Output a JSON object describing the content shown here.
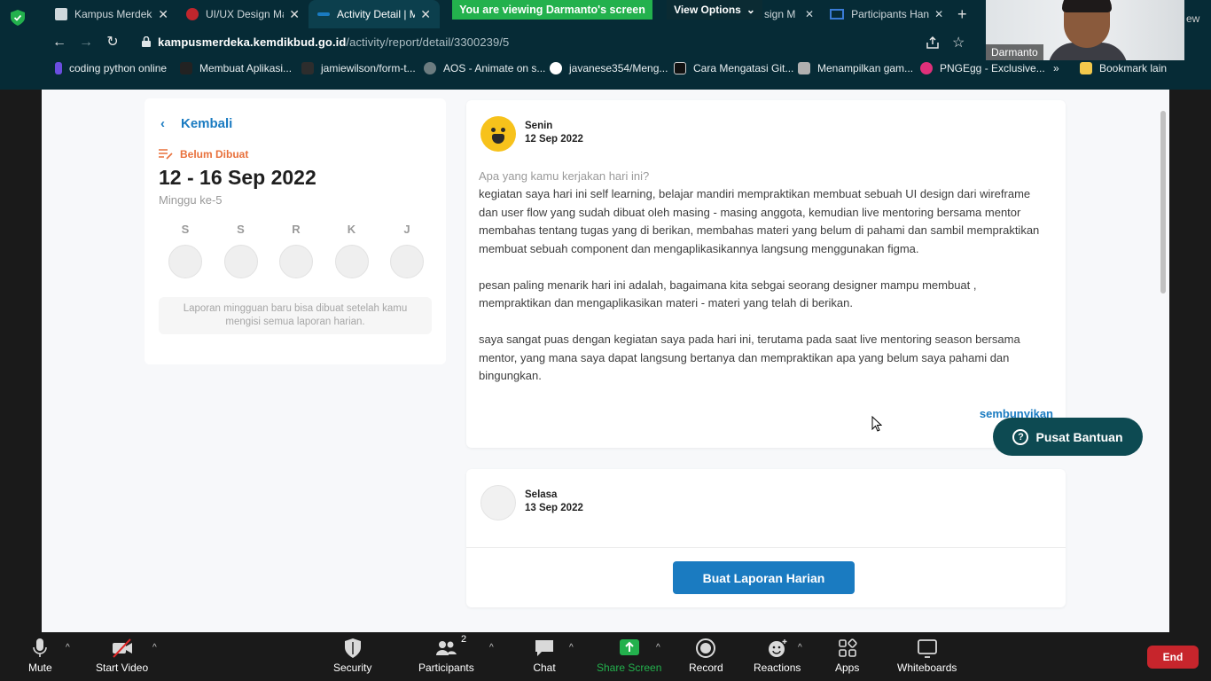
{
  "browser": {
    "tabs": [
      {
        "title": "Kampus Merdeka",
        "active": false,
        "color": "#cfd8dc"
      },
      {
        "title": "UI/UX Design Ma",
        "active": false,
        "color": "#c0262d"
      },
      {
        "title": "Activity Detail | M",
        "active": true,
        "color": "#1a7bc1"
      }
    ],
    "tabs_right": [
      {
        "title": "sign M",
        "color": "#7b3fc8"
      },
      {
        "title": "Participants Han",
        "color": "#3a7bd5"
      }
    ],
    "viewing_banner": "You are viewing Darmanto's screen",
    "view_options": "View Options",
    "url_host": "kampusmerdeka.kemdikbud.go.id",
    "url_path": "/activity/report/detail/3300239/5",
    "bookmarks": [
      "coding python online",
      "Membuat Aplikasi...",
      "jamiewilson/form-t...",
      "AOS - Animate on s...",
      "javanese354/Meng...",
      "Cara Mengatasi Git...",
      "Menampilkan gam...",
      "PNGEgg - Exclusive...",
      "»",
      "Bookmark lain"
    ]
  },
  "video": {
    "participant_name": "Darmanto",
    "view_label_cut": "ew"
  },
  "page": {
    "back_label": "Kembali",
    "status": "Belum Dibuat",
    "week_range": "12 - 16 Sep 2022",
    "week_number": "Minggu ke-5",
    "days": [
      "S",
      "S",
      "R",
      "K",
      "J"
    ],
    "weekly_note": "Laporan mingguan baru bisa dibuat setelah kamu mengisi semua laporan harian.",
    "report1": {
      "day": "Senin",
      "date": "12 Sep 2022",
      "question": "Apa yang kamu kerjakan hari ini?",
      "para1": "kegiatan saya hari ini self learning, belajar mandiri mempraktikan membuat sebuah UI design dari wireframe dan user flow yang sudah dibuat oleh masing - masing anggota, kemudian live mentoring bersama mentor membahas tentang tugas yang di berikan, membahas materi yang belum di pahami dan sambil mempraktikan membuat sebuah component dan mengaplikasikannya langsung menggunakan figma.",
      "para2": "pesan paling menarik hari ini adalah, bagaimana kita sebgai seorang designer mampu membuat , mempraktikan dan mengaplikasikan materi - materi yang telah di berikan.",
      "para3": "saya sangat puas dengan kegiatan saya pada hari ini, terutama pada saat live mentoring season bersama mentor, yang mana saya dapat langsung bertanya dan mempraktikan apa yang belum saya pahami dan bingungkan.",
      "hide_label": "sembunyikan"
    },
    "report2": {
      "day": "Selasa",
      "date": "13 Sep 2022",
      "create_label": "Buat Laporan Harian"
    },
    "help_label": "Pusat Bantuan"
  },
  "toolbar": {
    "mute": "Mute",
    "start_video": "Start Video",
    "security": "Security",
    "participants": "Participants",
    "participants_count": "2",
    "chat": "Chat",
    "share_screen": "Share Screen",
    "record": "Record",
    "reactions": "Reactions",
    "apps": "Apps",
    "whiteboards": "Whiteboards",
    "end": "End"
  },
  "colors": {
    "accent": "#1a7bc1",
    "status_orange": "#e8703b",
    "share_green": "#23b14d",
    "end_red": "#c7252c",
    "help_teal": "#0d4a52"
  }
}
